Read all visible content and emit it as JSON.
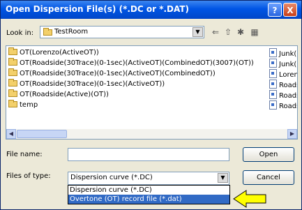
{
  "window": {
    "title": "Open Dispersion File(s) (*.DC or *.DAT)",
    "help_glyph": "?",
    "close_glyph": "X"
  },
  "lookin": {
    "label": "Look in:",
    "value": "TestRoom"
  },
  "toolbar": {
    "back_glyph": "⇐",
    "up_glyph": "⇧",
    "new_folder_glyph": "✱",
    "views_glyph": "▦"
  },
  "folders": [
    "OT(Lorenzo(ActiveOT))",
    "OT(Roadside(30Trace)(0-1sec)(ActiveOT)(CombinedOT)(3007)(OT))",
    "OT(Roadside(30Trace)(0-1sec)(ActiveOT)(CombinedOT))",
    "OT(Roadside(30Trace)(0-1sec)(ActiveOT))",
    "OT(Roadside(Active)(OT))",
    "temp"
  ],
  "files": [
    "Junk(C",
    "Junk(C",
    "Lorenz",
    "Roads",
    "Roads",
    "Roads"
  ],
  "filename": {
    "label": "File name:",
    "value": ""
  },
  "filetype": {
    "label": "Files of type:",
    "value": "Dispersion curve (*.DC)",
    "options": [
      "Dispersion curve (*.DC)",
      "Overtone (OT) record file (*.dat)"
    ],
    "selected_index": 1
  },
  "buttons": {
    "open": "Open",
    "cancel": "Cancel"
  },
  "colors": {
    "title_bar": "#0055e5",
    "selection": "#316ac5",
    "arrow": "#ffff00"
  }
}
